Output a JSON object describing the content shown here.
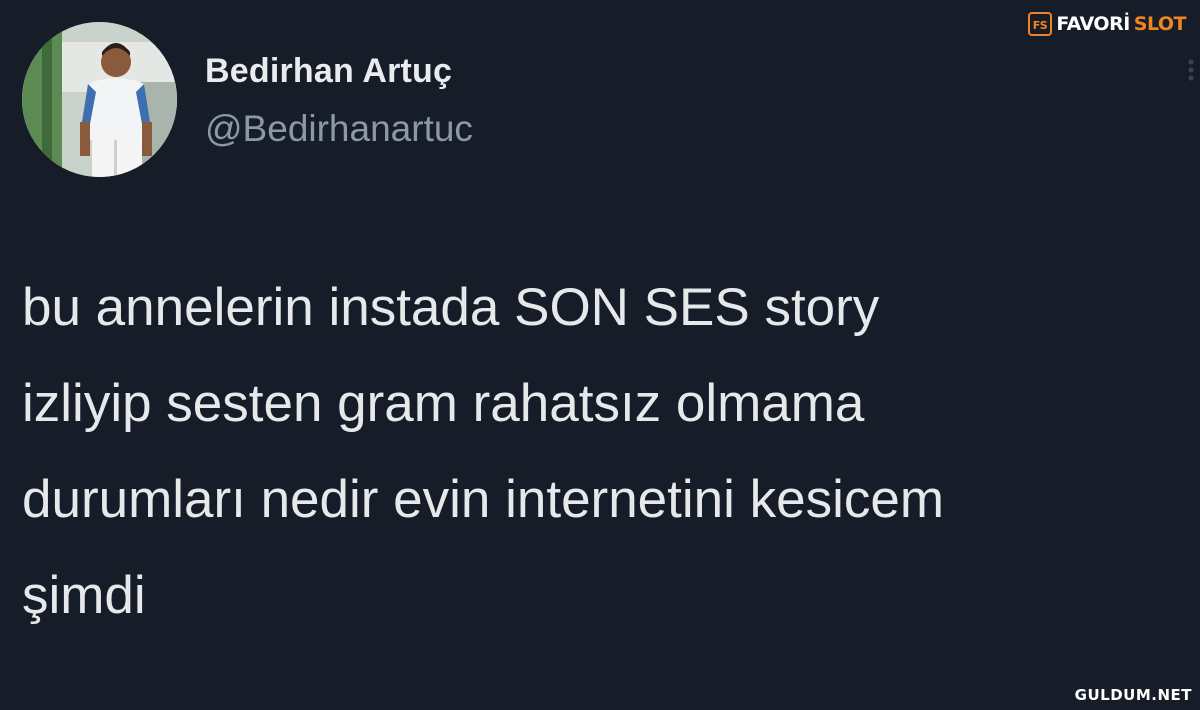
{
  "author": {
    "name": "Bedirhan Artuç",
    "handle": "@Bedirhanartuc"
  },
  "tweet": {
    "lines": [
      "bu annelerin instada SON SES story",
      "izliyip sesten gram rahatsız olmama",
      "durumları nedir evin internetini kesicem",
      "şimdi"
    ]
  },
  "watermarks": {
    "top_part1": "FAVORİ",
    "top_part2": "SLOT",
    "bottom": "GULDUM.NET"
  },
  "colors": {
    "background": "#161d28",
    "text": "#e6e8ea",
    "handle": "#8b98a5",
    "brand_accent": "#f0851e"
  },
  "icons": {
    "avatar": "avatar-photo",
    "more": "more-icon",
    "logo": "favorislot-logo-icon"
  }
}
